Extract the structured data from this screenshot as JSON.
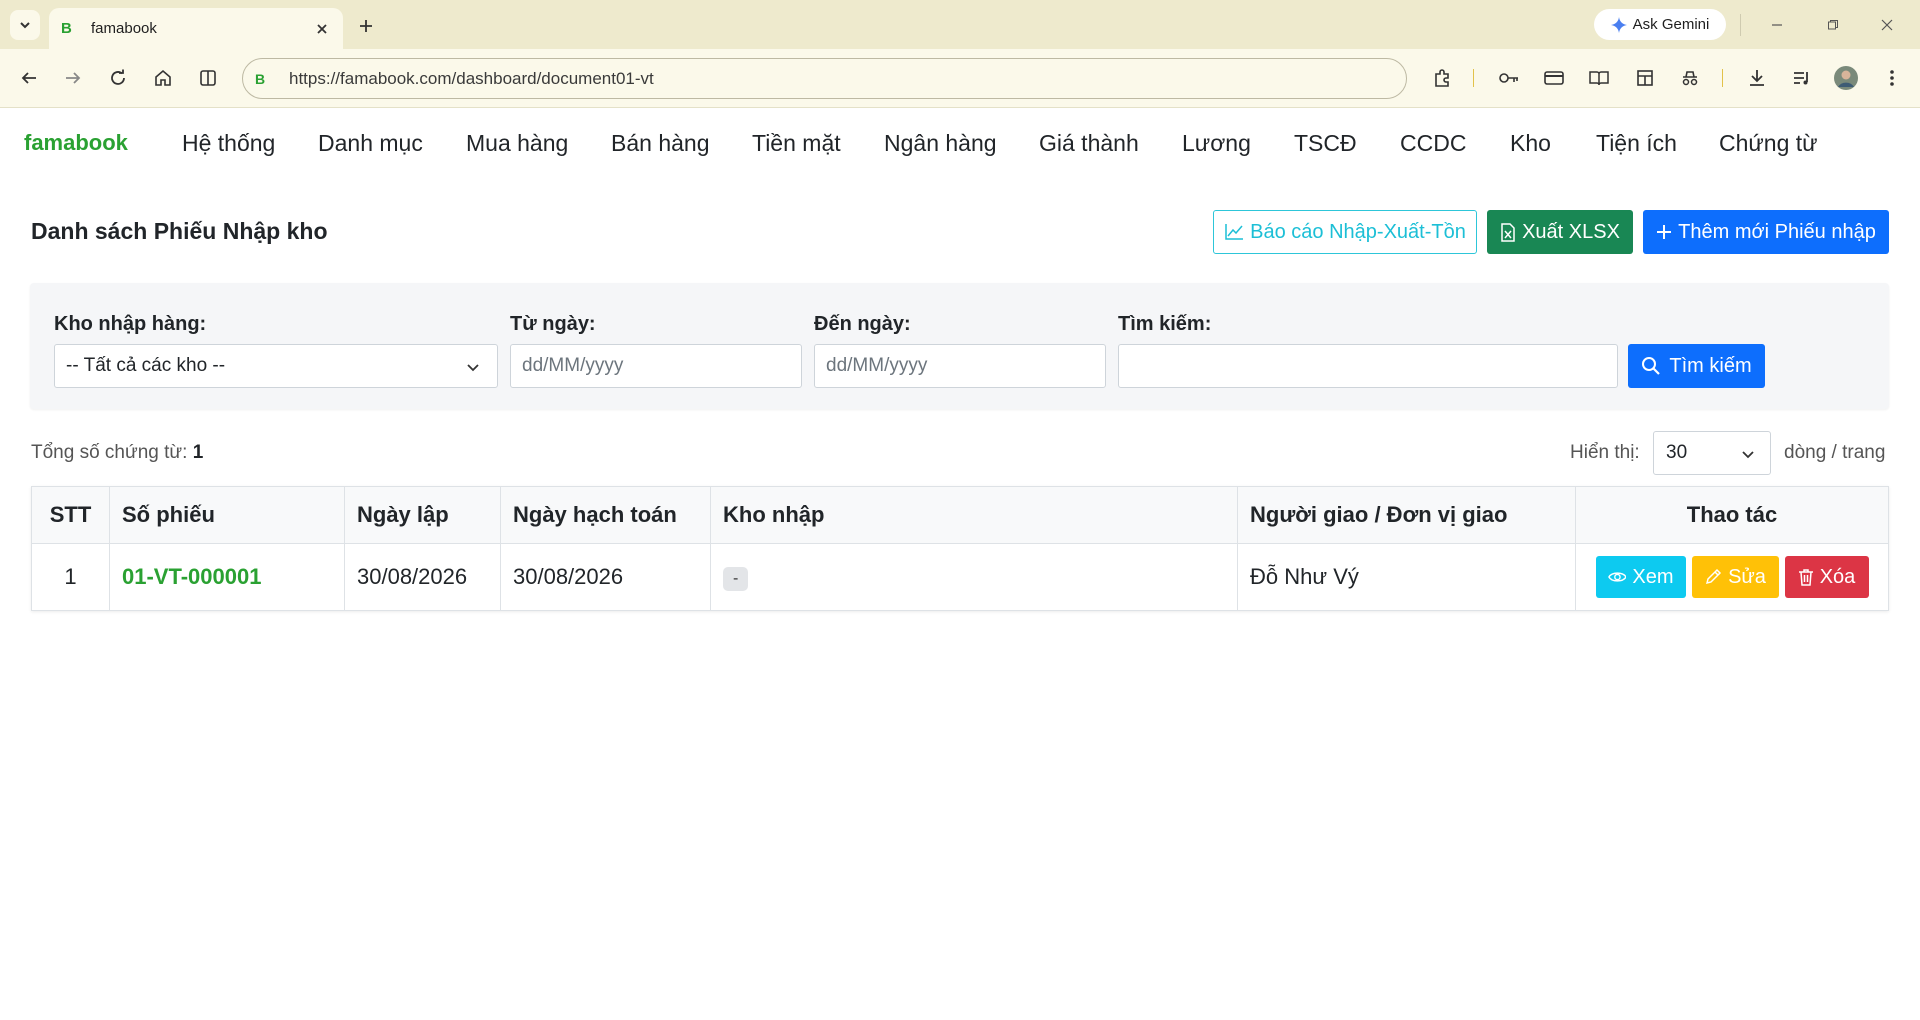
{
  "browser": {
    "tab_title": "famabook",
    "tab_favicon": "B",
    "url": "https://famabook.com/dashboard/document01-vt",
    "gemini_label": "Ask Gemini"
  },
  "app": {
    "brand": "famabook",
    "menu": [
      "Hệ thống",
      "Danh mục",
      "Mua hàng",
      "Bán hàng",
      "Tiền mặt",
      "Ngân hàng",
      "Giá thành",
      "Lương",
      "TSCĐ",
      "CCDC",
      "Kho",
      "Tiện ích",
      "Chứng từ"
    ]
  },
  "page": {
    "title": "Danh sách Phiếu Nhập kho",
    "btn_report": "Báo cáo Nhập-Xuất-Tồn",
    "btn_xlsx": "Xuất XLSX",
    "btn_add": "Thêm mới Phiếu nhập"
  },
  "filter": {
    "warehouse_label": "Kho nhập hàng:",
    "warehouse_value": "-- Tất cả các kho --",
    "from_label": "Từ ngày:",
    "from_placeholder": "dd/MM/yyyy",
    "to_label": "Đến ngày:",
    "to_placeholder": "dd/MM/yyyy",
    "search_label": "Tìm kiếm:",
    "search_value": "",
    "search_button": "Tìm kiếm"
  },
  "summary": {
    "total_label": "Tổng số chứng từ:",
    "total_value": "1",
    "show_label": "Hiển thị:",
    "page_size": "30",
    "per_page_label": "dòng / trang"
  },
  "table": {
    "headers": {
      "stt": "STT",
      "so_phieu": "Số phiếu",
      "ngay_lap": "Ngày lập",
      "ngay_hach_toan": "Ngày hạch toán",
      "kho_nhap": "Kho nhập",
      "nguoi_giao": "Người giao / Đơn vị giao",
      "thao_tac": "Thao tác"
    },
    "rows": [
      {
        "stt": "1",
        "so_phieu": "01-VT-000001",
        "ngay_lap": "30/08/2026",
        "ngay_hach_toan": "30/08/2026",
        "kho_nhap": "-",
        "nguoi_giao": "Đỗ Như Vý"
      }
    ],
    "actions": {
      "view": "Xem",
      "edit": "Sửa",
      "delete": "Xóa"
    }
  },
  "colors": {
    "brand_green": "#2aa132",
    "primary": "#0d6efd",
    "success": "#198754",
    "info": "#0dcaf0",
    "warning": "#ffc107",
    "danger": "#dc3545"
  }
}
